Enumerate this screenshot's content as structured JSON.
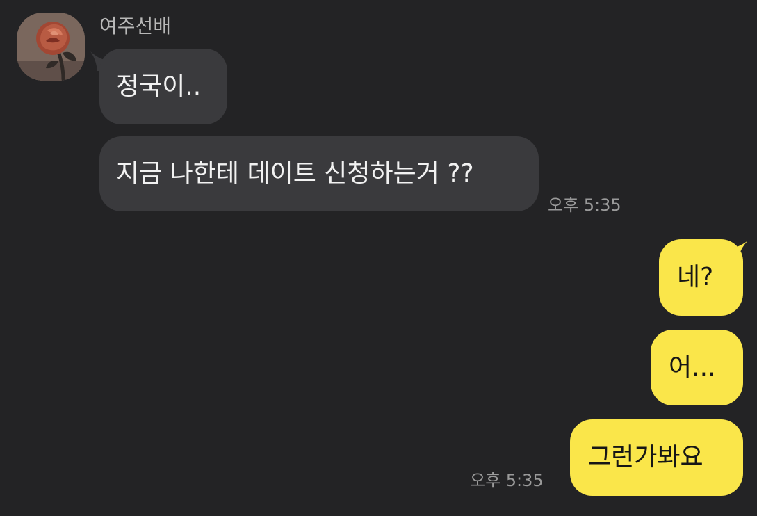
{
  "sender": {
    "name": "여주선배"
  },
  "incoming_messages": [
    "정국이..",
    "지금 나한테 데이트 신청하는거 ??"
  ],
  "incoming_time": "오후 5:35",
  "outgoing_messages": [
    "네?",
    "어...",
    "그런가봐요"
  ],
  "outgoing_time": "오후 5:35"
}
